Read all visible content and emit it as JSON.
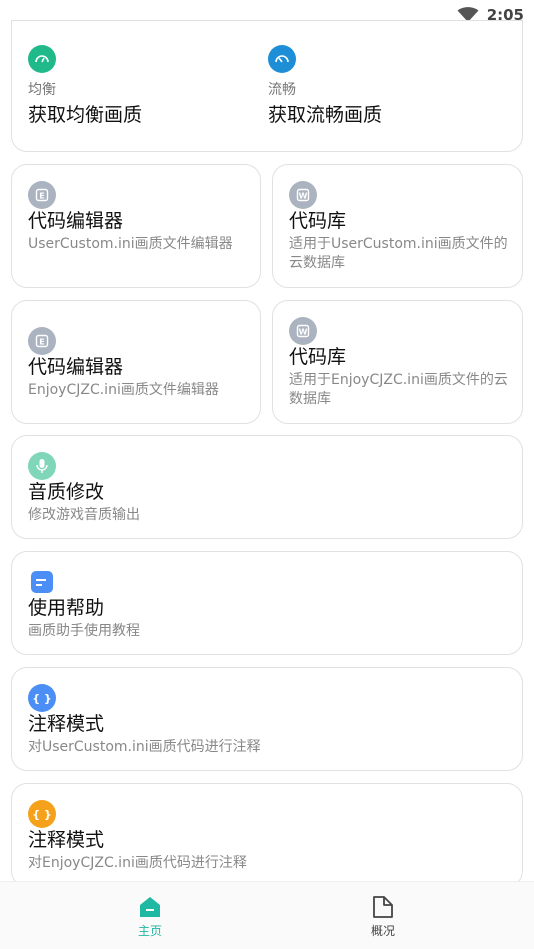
{
  "status_bar": {
    "time": "2:05"
  },
  "quality": {
    "balanced": {
      "label": "均衡",
      "action": "获取均衡画质",
      "color": "#1fb98a"
    },
    "smooth": {
      "label": "流畅",
      "action": "获取流畅画质",
      "color": "#1e8fd6"
    }
  },
  "cards": {
    "code_editor_1": {
      "title": "代码编辑器",
      "subtitle": "UserCustom.ini画质文件编辑器",
      "icon": "E"
    },
    "code_lib_1": {
      "title": "代码库",
      "subtitle": "适用于UserCustom.ini画质文件的云数据库",
      "icon": "W"
    },
    "code_editor_2": {
      "title": "代码编辑器",
      "subtitle": "EnjoyCJZC.ini画质文件编辑器",
      "icon": "E"
    },
    "code_lib_2": {
      "title": "代码库",
      "subtitle": "适用于EnjoyCJZC.ini画质文件的云数据库",
      "icon": "W"
    },
    "sound": {
      "title": "音质修改",
      "subtitle": "修改游戏音质输出",
      "color": "#7fd6b8"
    },
    "help": {
      "title": "使用帮助",
      "subtitle": "画质助手使用教程",
      "color": "#4b8ef5"
    },
    "annotate_1": {
      "title": "注释模式",
      "subtitle": "对UserCustom.ini画质代码进行注释",
      "icon": "{ }",
      "color": "#4b8ef5"
    },
    "annotate_2": {
      "title": "注释模式",
      "subtitle": "对EnjoyCJZC.ini画质代码进行注释",
      "icon": "{ }",
      "color": "#f5a11c"
    }
  },
  "nav": {
    "home": {
      "label": "主页",
      "color": "#1fb9a3"
    },
    "overview": {
      "label": "概况",
      "color": "#444444"
    }
  }
}
